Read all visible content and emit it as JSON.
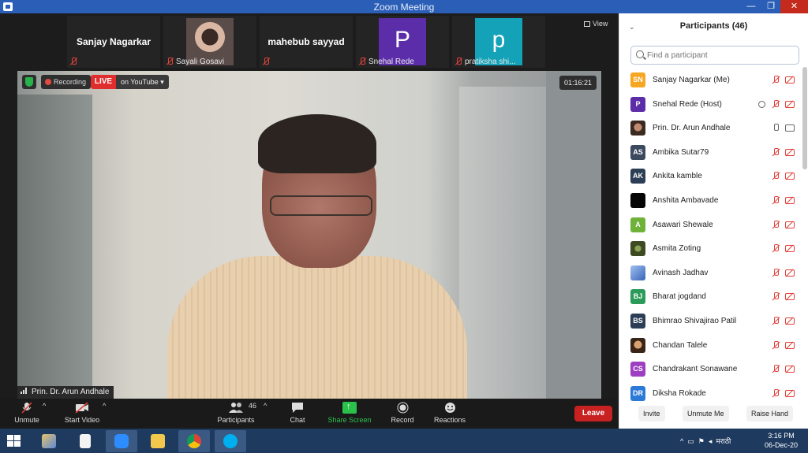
{
  "window": {
    "title": "Zoom Meeting",
    "minimize": "—",
    "maximize": "❐",
    "close": "✕"
  },
  "strip": {
    "tiles": [
      {
        "name": "Sanjay Nagarkar",
        "label": ""
      },
      {
        "name": "",
        "label": "Sayali Gosavi"
      },
      {
        "name": "mahebub sayyad",
        "label": ""
      },
      {
        "name": "",
        "label": "Snehal Rede",
        "avatar": "P"
      },
      {
        "name": "",
        "label": "pratiksha shi...",
        "avatar": "p"
      }
    ],
    "view_label": "View",
    "next_glyph": "›"
  },
  "video": {
    "recording": "Recording",
    "live": "LIVE",
    "youtube": "on YouTube ▾",
    "timer": "01:16:21",
    "speaker": "Prin. Dr. Arun Andhale"
  },
  "toolbar": {
    "unmute": "Unmute",
    "start_video": "Start Video",
    "participants": "Participants",
    "participants_count": "46",
    "chat": "Chat",
    "share": "Share Screen",
    "record": "Record",
    "reactions": "Reactions",
    "leave": "Leave"
  },
  "panel": {
    "title": "Participants (46)",
    "search_placeholder": "Find a participant",
    "participants": [
      {
        "initials": "SN",
        "name": "Sanjay Nagarkar (Me)",
        "color": "#f5a623",
        "mic": "muted",
        "cam": "off"
      },
      {
        "initials": "P",
        "name": "Snehal Rede (Host)",
        "color": "#5b2da8",
        "mic": "muted",
        "cam": "off",
        "host": true
      },
      {
        "initials": "",
        "name": "Prin. Dr. Arun Andhale",
        "color": "#6b4a3a",
        "mic": "on",
        "cam": "on"
      },
      {
        "initials": "AS",
        "name": "Ambika Sutar79",
        "color": "#3b4a5e",
        "mic": "muted",
        "cam": "off"
      },
      {
        "initials": "AK",
        "name": "Ankita kamble",
        "color": "#2b3e55",
        "mic": "muted",
        "cam": "off"
      },
      {
        "initials": "",
        "name": "Anshita Ambavade",
        "color": "#050505",
        "mic": "muted",
        "cam": "off"
      },
      {
        "initials": "A",
        "name": "Asawari Shewale",
        "color": "#6fb23a",
        "mic": "muted",
        "cam": "off"
      },
      {
        "initials": "",
        "name": "Asmita Zoting",
        "color": "#556b2f",
        "mic": "muted",
        "cam": "off"
      },
      {
        "initials": "",
        "name": "Avinash Jadhav",
        "color": "#6b8fd6",
        "mic": "muted",
        "cam": "off"
      },
      {
        "initials": "BJ",
        "name": "Bharat jogdand",
        "color": "#2c9b5a",
        "mic": "muted",
        "cam": "off"
      },
      {
        "initials": "BS",
        "name": "Bhimrao Shivajirao Patil",
        "color": "#2b3e55",
        "mic": "muted",
        "cam": "off"
      },
      {
        "initials": "",
        "name": "Chandan Talele",
        "color": "#7a5030",
        "mic": "muted",
        "cam": "off"
      },
      {
        "initials": "CS",
        "name": "Chandrakant Sonawane",
        "color": "#9c3fc0",
        "mic": "muted",
        "cam": "off"
      },
      {
        "initials": "DR",
        "name": "Diksha Rokade",
        "color": "#2d7ad6",
        "mic": "muted",
        "cam": "off"
      }
    ],
    "footer": {
      "invite": "Invite",
      "unmute_me": "Unmute Me",
      "raise_hand": "Raise Hand"
    }
  },
  "taskbar": {
    "language": "मराठी",
    "time": "3:16 PM",
    "date": "06-Dec-20"
  }
}
